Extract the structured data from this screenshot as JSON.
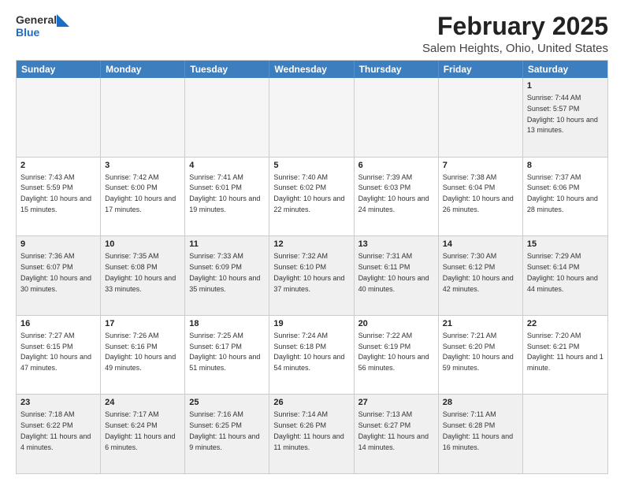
{
  "header": {
    "logo_general": "General",
    "logo_blue": "Blue",
    "month_title": "February 2025",
    "location": "Salem Heights, Ohio, United States"
  },
  "calendar": {
    "days_of_week": [
      "Sunday",
      "Monday",
      "Tuesday",
      "Wednesday",
      "Thursday",
      "Friday",
      "Saturday"
    ],
    "weeks": [
      [
        {
          "day": "",
          "info": "",
          "empty": true
        },
        {
          "day": "",
          "info": "",
          "empty": true
        },
        {
          "day": "",
          "info": "",
          "empty": true
        },
        {
          "day": "",
          "info": "",
          "empty": true
        },
        {
          "day": "",
          "info": "",
          "empty": true
        },
        {
          "day": "",
          "info": "",
          "empty": true
        },
        {
          "day": "1",
          "info": "Sunrise: 7:44 AM\nSunset: 5:57 PM\nDaylight: 10 hours and 13 minutes."
        }
      ],
      [
        {
          "day": "2",
          "info": "Sunrise: 7:43 AM\nSunset: 5:59 PM\nDaylight: 10 hours and 15 minutes."
        },
        {
          "day": "3",
          "info": "Sunrise: 7:42 AM\nSunset: 6:00 PM\nDaylight: 10 hours and 17 minutes."
        },
        {
          "day": "4",
          "info": "Sunrise: 7:41 AM\nSunset: 6:01 PM\nDaylight: 10 hours and 19 minutes."
        },
        {
          "day": "5",
          "info": "Sunrise: 7:40 AM\nSunset: 6:02 PM\nDaylight: 10 hours and 22 minutes."
        },
        {
          "day": "6",
          "info": "Sunrise: 7:39 AM\nSunset: 6:03 PM\nDaylight: 10 hours and 24 minutes."
        },
        {
          "day": "7",
          "info": "Sunrise: 7:38 AM\nSunset: 6:04 PM\nDaylight: 10 hours and 26 minutes."
        },
        {
          "day": "8",
          "info": "Sunrise: 7:37 AM\nSunset: 6:06 PM\nDaylight: 10 hours and 28 minutes."
        }
      ],
      [
        {
          "day": "9",
          "info": "Sunrise: 7:36 AM\nSunset: 6:07 PM\nDaylight: 10 hours and 30 minutes."
        },
        {
          "day": "10",
          "info": "Sunrise: 7:35 AM\nSunset: 6:08 PM\nDaylight: 10 hours and 33 minutes."
        },
        {
          "day": "11",
          "info": "Sunrise: 7:33 AM\nSunset: 6:09 PM\nDaylight: 10 hours and 35 minutes."
        },
        {
          "day": "12",
          "info": "Sunrise: 7:32 AM\nSunset: 6:10 PM\nDaylight: 10 hours and 37 minutes."
        },
        {
          "day": "13",
          "info": "Sunrise: 7:31 AM\nSunset: 6:11 PM\nDaylight: 10 hours and 40 minutes."
        },
        {
          "day": "14",
          "info": "Sunrise: 7:30 AM\nSunset: 6:12 PM\nDaylight: 10 hours and 42 minutes."
        },
        {
          "day": "15",
          "info": "Sunrise: 7:29 AM\nSunset: 6:14 PM\nDaylight: 10 hours and 44 minutes."
        }
      ],
      [
        {
          "day": "16",
          "info": "Sunrise: 7:27 AM\nSunset: 6:15 PM\nDaylight: 10 hours and 47 minutes."
        },
        {
          "day": "17",
          "info": "Sunrise: 7:26 AM\nSunset: 6:16 PM\nDaylight: 10 hours and 49 minutes."
        },
        {
          "day": "18",
          "info": "Sunrise: 7:25 AM\nSunset: 6:17 PM\nDaylight: 10 hours and 51 minutes."
        },
        {
          "day": "19",
          "info": "Sunrise: 7:24 AM\nSunset: 6:18 PM\nDaylight: 10 hours and 54 minutes."
        },
        {
          "day": "20",
          "info": "Sunrise: 7:22 AM\nSunset: 6:19 PM\nDaylight: 10 hours and 56 minutes."
        },
        {
          "day": "21",
          "info": "Sunrise: 7:21 AM\nSunset: 6:20 PM\nDaylight: 10 hours and 59 minutes."
        },
        {
          "day": "22",
          "info": "Sunrise: 7:20 AM\nSunset: 6:21 PM\nDaylight: 11 hours and 1 minute."
        }
      ],
      [
        {
          "day": "23",
          "info": "Sunrise: 7:18 AM\nSunset: 6:22 PM\nDaylight: 11 hours and 4 minutes."
        },
        {
          "day": "24",
          "info": "Sunrise: 7:17 AM\nSunset: 6:24 PM\nDaylight: 11 hours and 6 minutes."
        },
        {
          "day": "25",
          "info": "Sunrise: 7:16 AM\nSunset: 6:25 PM\nDaylight: 11 hours and 9 minutes."
        },
        {
          "day": "26",
          "info": "Sunrise: 7:14 AM\nSunset: 6:26 PM\nDaylight: 11 hours and 11 minutes."
        },
        {
          "day": "27",
          "info": "Sunrise: 7:13 AM\nSunset: 6:27 PM\nDaylight: 11 hours and 14 minutes."
        },
        {
          "day": "28",
          "info": "Sunrise: 7:11 AM\nSunset: 6:28 PM\nDaylight: 11 hours and 16 minutes."
        },
        {
          "day": "",
          "info": "",
          "empty": true
        }
      ]
    ]
  }
}
